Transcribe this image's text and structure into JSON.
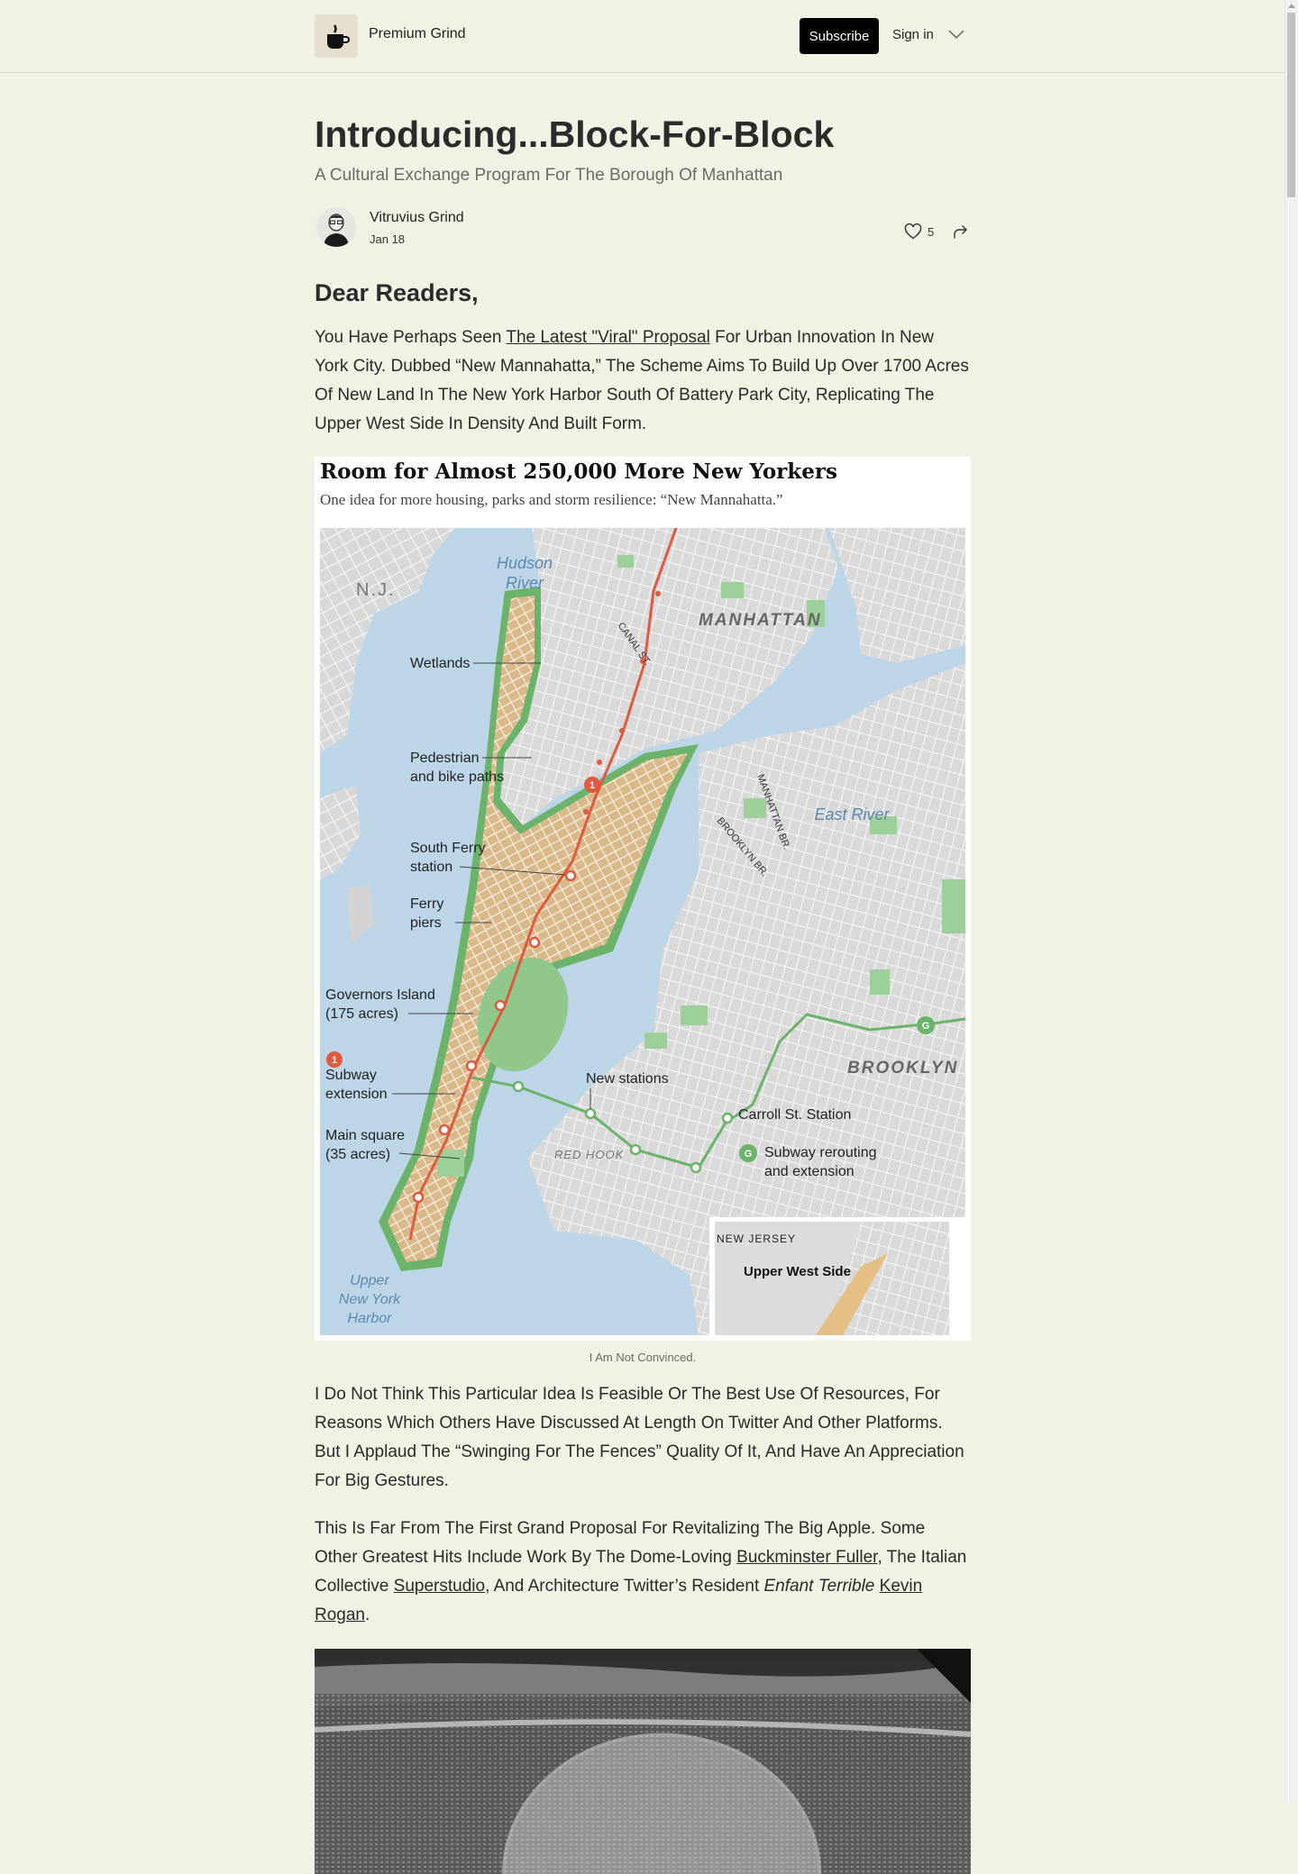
{
  "header": {
    "publication_name": "Premium Grind",
    "subscribe_label": "Subscribe",
    "signin_label": "Sign in"
  },
  "article": {
    "title": "Introducing...Block-For-Block",
    "subtitle": "A Cultural Exchange Program For The Borough Of Manhattan",
    "author": "Vitruvius Grind",
    "date": "Jan 18",
    "like_count": "5",
    "greeting": "Dear Readers,",
    "p1": {
      "before": "You Have Perhaps Seen ",
      "link": "The Latest \"Viral\" Proposal",
      "after": " For Urban Innovation In New York City. Dubbed “New Mannahatta,” The Scheme Aims To Build Up Over 1700 Acres Of New Land In The New York Harbor South Of Battery Park City, Replicating The Upper West Side In Density And Built Form."
    },
    "figure": {
      "title": "Room for Almost 250,000 More New Yorkers",
      "subtitle": "One idea for more housing, parks and storm resilience: “New Mannahatta.”",
      "caption": "I Am Not Convinced.",
      "map_labels": {
        "nj": "N.J.",
        "hudson": [
          "Hudson",
          "River"
        ],
        "manhattan": "MANHATTAN",
        "canal": "CANAL ST.",
        "wetlands": "Wetlands",
        "pedestrian": [
          "Pedestrian",
          "and bike paths"
        ],
        "south_ferry": [
          "South Ferry",
          "station"
        ],
        "ferry_piers": [
          "Ferry",
          "piers"
        ],
        "governors": [
          "Governors Island",
          "(175 acres)"
        ],
        "subway_ext": [
          "Subway",
          "extension"
        ],
        "main_square": [
          "Main square",
          "(35 acres)"
        ],
        "upper_harbor": [
          "Upper",
          "New York",
          "Harbor"
        ],
        "manhattan_br": "MANHATTAN BR.",
        "brooklyn_br": "BROOKLYN BR.",
        "east_river": "East River",
        "brooklyn": "BROOKLYN",
        "new_stations": "New stations",
        "carroll": "Carroll St. Station",
        "red_hook": "RED HOOK",
        "rerouting": [
          "Subway rerouting",
          "and extension"
        ],
        "new_jersey": "NEW JERSEY",
        "uws": "Upper West Side",
        "line1": "1",
        "lineG": "G"
      }
    },
    "p2": "I Do Not Think This Particular Idea Is Feasible Or The Best Use Of Resources, For Reasons Which Others Have Discussed At Length On Twitter And Other Platforms. But I Applaud The “Swinging For The Fences” Quality Of It, And Have An Appreciation For Big Gestures.",
    "p3": {
      "a": "This Is Far From The First Grand Proposal For Revitalizing The Big Apple. Some Other Greatest Hits Include Work By The Dome-Loving ",
      "link1": "Buckminster Fuller",
      "b": ", The Italian Collective ",
      "link2": "Superstudio",
      "c": ", And Architecture Twitter’s Resident ",
      "italic": "Enfant Terrible",
      "d": " ",
      "link3": "Kevin Rogan",
      "e": "."
    }
  },
  "colors": {
    "background": "#f1f1e4",
    "button": "#000000",
    "water": "#bcd6e8",
    "new_land": "#d9b98a",
    "park_green": "#6bb36b",
    "subway_red": "#e05a3f"
  }
}
